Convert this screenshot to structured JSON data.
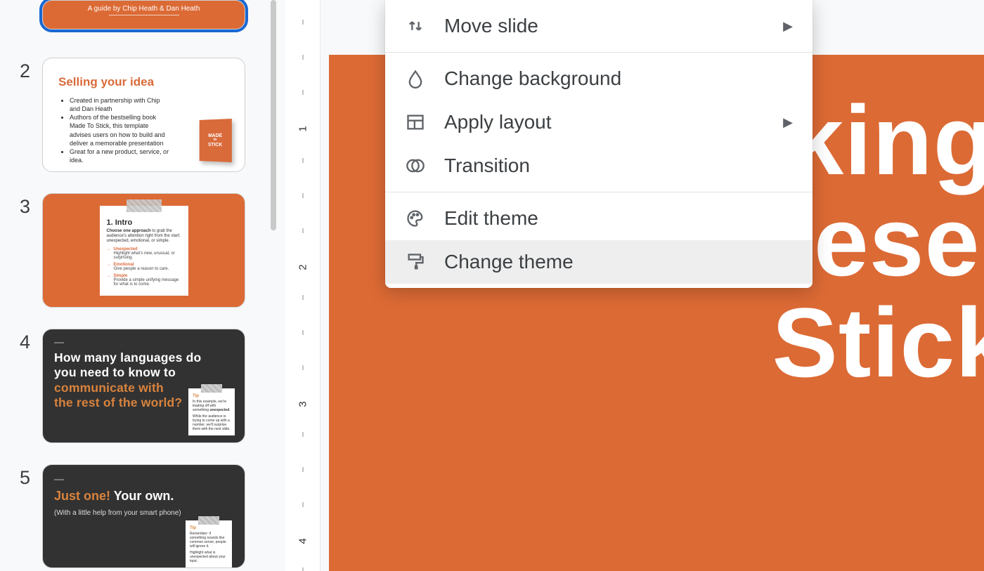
{
  "colors": {
    "accent_orange": "#dc6a35",
    "dark_slide": "#323232",
    "selection_blue": "#1967d2"
  },
  "slides": {
    "s1": {
      "number": "",
      "subtitle": "A guide by Chip Heath & Dan Heath"
    },
    "s2": {
      "number": "2",
      "title": "Selling your idea",
      "bullets": [
        "Created in partnership with Chip and Dan Heath",
        "Authors of the bestselling book Made To Stick, this template advises users on how to build and deliver a memorable presentation",
        "Great for a new product, service, or idea."
      ],
      "book_line1": "MADE",
      "book_line2": "to",
      "book_line3": "STICK"
    },
    "s3": {
      "number": "3",
      "note_title": "1. Intro",
      "lead_strong": "Choose one approach",
      "lead_rest": " to grab the audience's attention right from the start: unexpected, emotional, or simple.",
      "items": [
        {
          "label": "Unexpected",
          "desc": "Highlight what's new, unusual, or surprising."
        },
        {
          "label": "Emotional",
          "desc": "Give people a reason to care."
        },
        {
          "label": "Simple",
          "desc": "Provide a simple unifying message for what is to come."
        }
      ]
    },
    "s4": {
      "number": "4",
      "line1": "How many languages do",
      "line2": "you need to know to",
      "line3": "communicate with",
      "line4": "the rest of the world?",
      "tip_label": "Tip",
      "tip_body1": "In this example, we're leading off with something ",
      "tip_bold": "unexpected",
      "tip_body2": "While the audience is trying to come up with a number, we'll surprise them with the next slide."
    },
    "s5": {
      "number": "5",
      "headline_orange": "Just one!",
      "headline_rest": " Your own.",
      "sub": "(With a little help from your smart phone)",
      "tip_label": "Tip",
      "tip_body1": "Remember: if something sounds like common sense, people will ignore it.",
      "tip_body2": "Highlight what is unexpected about your topic."
    }
  },
  "canvas": {
    "title_line1": "king",
    "title_line2": "Present",
    "title_line3": "Stick"
  },
  "ruler": {
    "labels": [
      "1",
      "2",
      "3",
      "4"
    ]
  },
  "menu": {
    "move_slide": "Move slide",
    "change_background": "Change background",
    "apply_layout": "Apply layout",
    "transition": "Transition",
    "edit_theme": "Edit theme",
    "change_theme": "Change theme"
  }
}
